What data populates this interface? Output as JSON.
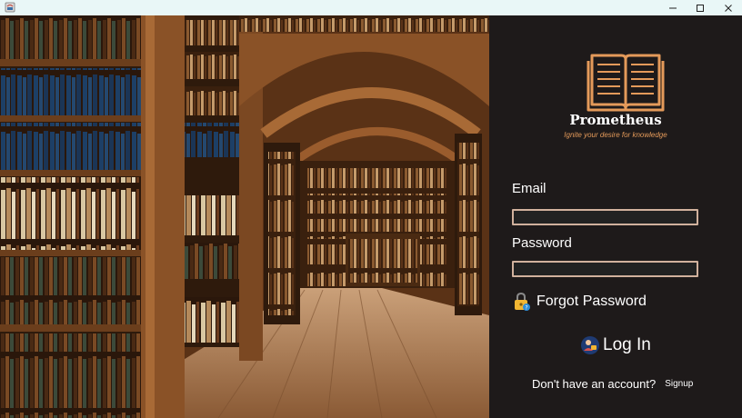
{
  "window": {
    "icon": "java-app-icon",
    "buttons": [
      "minimize",
      "maximize",
      "close"
    ]
  },
  "brand": {
    "name": "Prometheus",
    "tagline": "Ignite your desire for knowledge",
    "logo": "open-book-icon",
    "accent": "#e49a5a"
  },
  "form": {
    "email_label": "Email",
    "email_value": "",
    "password_label": "Password",
    "password_value": "",
    "forgot_label": "Forgot Password",
    "login_label": "Log In",
    "no_account_text": "Don't have an account?",
    "signup_label": "Signup"
  },
  "colors": {
    "panel_bg": "#1e1a1a",
    "field_border": "#d1b19d",
    "titlebar_bg": "#e9f7f7"
  }
}
